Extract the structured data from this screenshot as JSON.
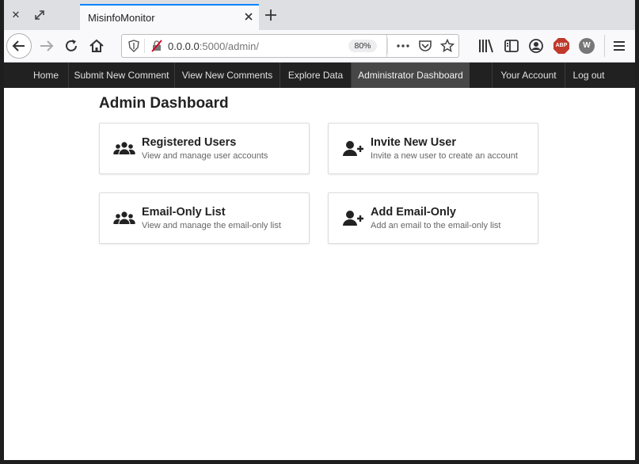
{
  "browser": {
    "tab_title": "MisinfoMonitor",
    "url_host": "0.0.0.0",
    "url_path": ":5000/admin/",
    "zoom": "80%",
    "extension_w": "W",
    "extension_abp": "ABP"
  },
  "site_nav": {
    "items": [
      {
        "label": "Home"
      },
      {
        "label": "Submit New Comment"
      },
      {
        "label": "View New Comments"
      },
      {
        "label": "Explore Data"
      },
      {
        "label": "Administrator Dashboard",
        "active": true
      },
      {
        "label": "Your Account"
      },
      {
        "label": "Log out"
      }
    ]
  },
  "page": {
    "title": "Admin Dashboard",
    "cards": [
      {
        "title": "Registered Users",
        "desc": "View and manage user accounts",
        "icon": "users-icon"
      },
      {
        "title": "Invite New User",
        "desc": "Invite a new user to create an account",
        "icon": "user-plus-icon"
      },
      {
        "title": "Email-Only List",
        "desc": "View and manage the email-only list",
        "icon": "users-icon"
      },
      {
        "title": "Add Email-Only",
        "desc": "Add an email to the email-only list",
        "icon": "user-plus-icon"
      }
    ]
  },
  "colors": {
    "site_nav_bg": "#212121",
    "site_nav_active": "#474747",
    "tab_accent": "#0a84ff"
  }
}
